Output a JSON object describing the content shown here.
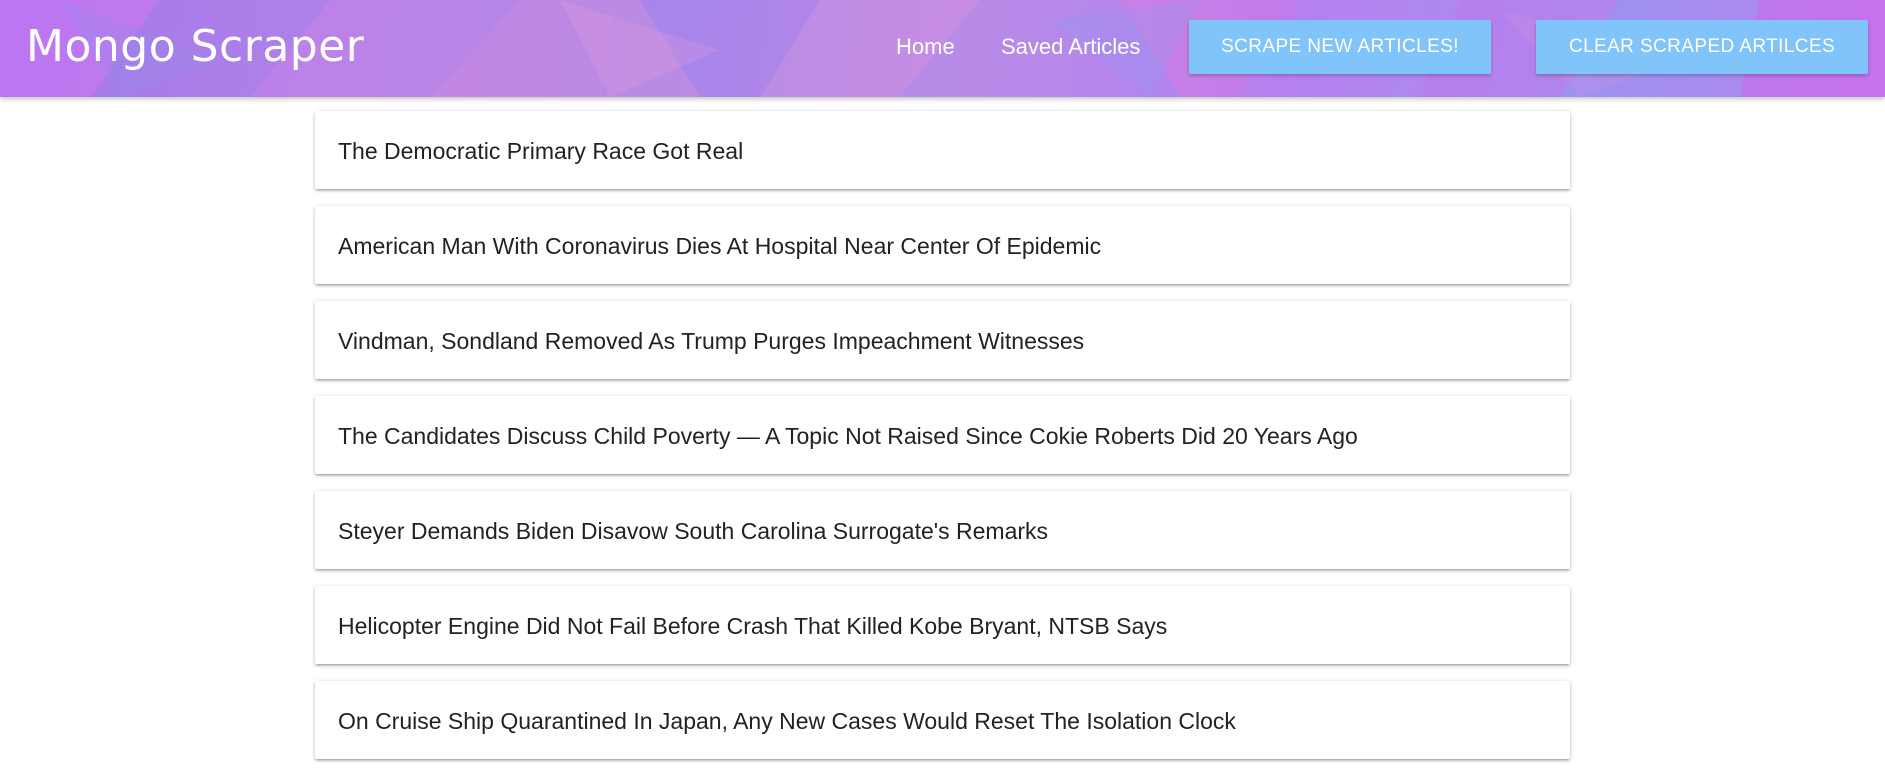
{
  "navbar": {
    "brand": "Mongo Scraper",
    "links": {
      "home": "Home",
      "saved": "Saved Articles"
    },
    "buttons": {
      "scrape": "SCRAPE NEW ARTICLES!",
      "clear": "CLEAR SCRAPED ARTILCES"
    },
    "colors": {
      "button_bg": "#80c4fa",
      "text": "#ffffff"
    }
  },
  "articles": [
    {
      "title": "The Democratic Primary Race Got Real"
    },
    {
      "title": "American Man With Coronavirus Dies At Hospital Near Center Of Epidemic"
    },
    {
      "title": "Vindman, Sondland Removed As Trump Purges Impeachment Witnesses"
    },
    {
      "title": "The Candidates Discuss Child Poverty — A Topic Not Raised Since Cokie Roberts Did 20 Years Ago"
    },
    {
      "title": "Steyer Demands Biden Disavow South Carolina Surrogate's Remarks"
    },
    {
      "title": "Helicopter Engine Did Not Fail Before Crash That Killed Kobe Bryant, NTSB Says"
    },
    {
      "title": "On Cruise Ship Quarantined In Japan, Any New Cases Would Reset The Isolation Clock"
    }
  ]
}
